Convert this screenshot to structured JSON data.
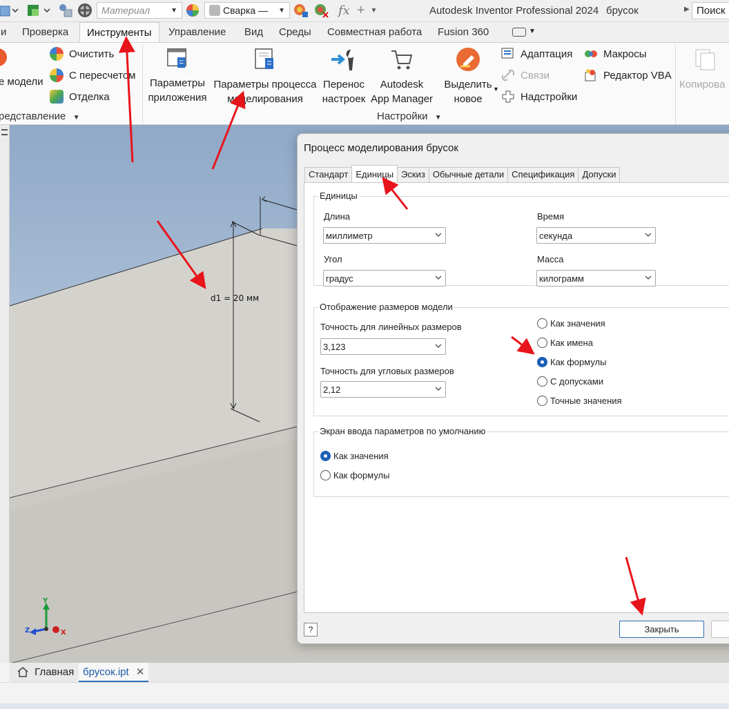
{
  "title_bar": {
    "material_combo": "Материал",
    "appearance_combo": "Сварка —",
    "app_title": "Autodesk Inventor Professional 2024",
    "document_title": "брусок",
    "search_text": "Поиск"
  },
  "ribbon_tabs": [
    "и",
    "Проверка",
    "Инструменты",
    "Управление",
    "Вид",
    "Среды",
    "Совместная работа",
    "Fusion 360"
  ],
  "ribbon": {
    "clean_model_label": "е модели",
    "clear_label": "Очистить",
    "recompute_label": "С пересчетом",
    "finish_label": "Отделка",
    "representation_group": "редставление",
    "app_options_line1": "Параметры",
    "app_options_line2": "приложения",
    "doc_settings_line1": "Параметры процесса",
    "doc_settings_line2": "моделирования",
    "migrate_line1": "Перенос",
    "migrate_line2": "настроек",
    "appmgr_line1": "Autodesk",
    "appmgr_line2": "App Manager",
    "highlight_line1": "Выделить",
    "highlight_line2": "новое",
    "adaptation_label": "Адаптация",
    "links_label": "Связи",
    "addins_label": "Надстройки",
    "macros_label": "Макросы",
    "vba_label": "Редактор VBA",
    "copy_label": "Копирова",
    "settings_group": "Настройки"
  },
  "viewport": {
    "dimension_label": "d1 = 20 мм",
    "axis_y": "Y",
    "axis_x": "X",
    "axis_z": "Z"
  },
  "document_tabs": {
    "home_label": "Главная",
    "file_label": "брусок.ipt"
  },
  "dialog": {
    "title": "Процесс моделирования брусок",
    "tabs": [
      "Стандарт",
      "Единицы",
      "Эскиз",
      "Обычные детали",
      "Спецификация",
      "Допуски"
    ],
    "units_group": "Единицы",
    "length_label": "Длина",
    "length_value": "миллиметр",
    "time_label": "Время",
    "time_value": "секунда",
    "angle_label": "Угол",
    "angle_value": "градус",
    "mass_label": "Масса",
    "mass_value": "килограмм",
    "display_group": "Отображение размеров модели",
    "linear_precision_label": "Точность для линейных размеров",
    "linear_precision_value": "3,123",
    "angular_precision_label": "Точность для угловых размеров",
    "angular_precision_value": "2,12",
    "display_options": [
      "Как значения",
      "Как имена",
      "Как формулы",
      "С допусками",
      "Точные значения"
    ],
    "display_selected": "Как формулы",
    "input_group": "Экран ввода параметров по умолчанию",
    "input_options": [
      "Как значения",
      "Как формулы"
    ],
    "input_selected": "Как значения",
    "help_label": "?",
    "close_label": "Закрыть"
  },
  "colors": {
    "accent_blue": "#1a5fb4",
    "annotation_red": "#e8141b",
    "viewport_sky": "#a9bdd6"
  }
}
